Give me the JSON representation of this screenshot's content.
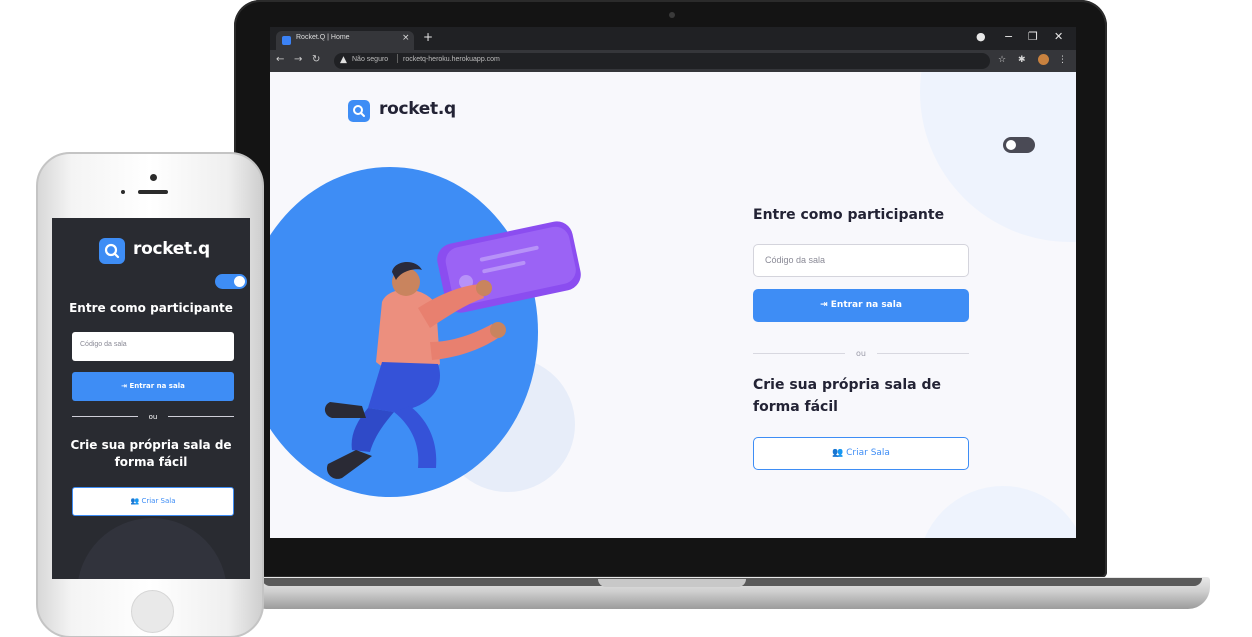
{
  "browser": {
    "tab_title": "Rocket.Q | Home",
    "tab_close": "×",
    "new_tab": "+",
    "security_label": "Não seguro",
    "url": "rocketq-heroku.herokuapp.com"
  },
  "app": {
    "logo_text": "rocket.q",
    "dark_mode_on_desktop": false,
    "dark_mode_on_phone": true
  },
  "join": {
    "title": "Entre como participante",
    "room_code_placeholder": "Código da sala",
    "enter_button": "Entrar na sala"
  },
  "divider_text": "ou",
  "create": {
    "title": "Crie sua própria sala de forma fácil",
    "title_line1": "Crie sua própria sala de",
    "title_line2": "forma fácil",
    "create_button": "Criar Sala"
  },
  "colors": {
    "brand_blue": "#3E8DF5",
    "page_bg": "#F8F8FC",
    "dark_bg": "#292B31",
    "purple_card": "#8B4DF0"
  },
  "icons": {
    "logo": "search-icon",
    "enter": "log-in-icon",
    "create": "users-icon"
  }
}
